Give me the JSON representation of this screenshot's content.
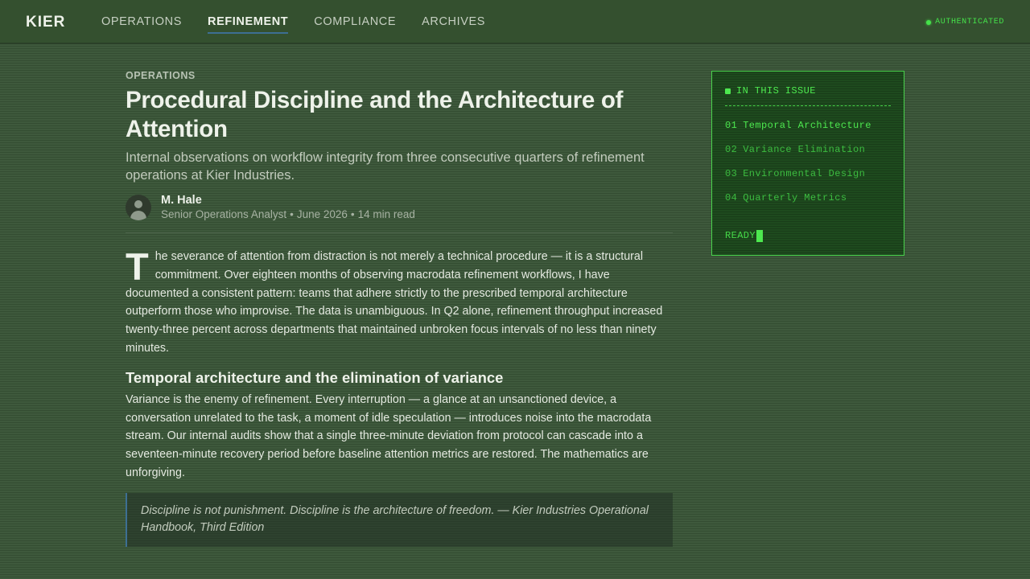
{
  "brand": "KIER",
  "nav": {
    "items": [
      {
        "label": "OPERATIONS"
      },
      {
        "label": "REFINEMENT"
      },
      {
        "label": "COMPLIANCE"
      },
      {
        "label": "ARCHIVES"
      }
    ],
    "active": "REFINEMENT",
    "status": "AUTHENTICATED"
  },
  "article": {
    "kicker": "OPERATIONS",
    "title": "Procedural Discipline and the Architecture of Attention",
    "subtitle": "Internal observations on workflow integrity from three consecutive quarters of refinement operations at Kier Industries.",
    "author": {
      "name": "M. Hale",
      "role": "Senior Operations Analyst",
      "date": "June 2026",
      "read_time": "14 min read",
      "separator": "•"
    },
    "dropcap": "T",
    "intro": "he severance of attention from distraction is not merely a technical procedure — it is a structural commitment. Over eighteen months of observing macrodata refinement workflows, I have documented a consistent pattern: teams that adhere strictly to the prescribed temporal architecture outperform those who improvise. The data is unambiguous. In Q2 alone, refinement throughput increased twenty-three percent across departments that maintained unbroken focus intervals of no less than ninety minutes.",
    "section_heading": "Temporal architecture and the elimination of variance",
    "section_body": "Variance is the enemy of refinement. Every interruption — a glance at an unsanctioned device, a conversation unrelated to the task, a moment of idle speculation — introduces noise into the macrodata stream. Our internal audits show that a single three-minute deviation from protocol can cascade into a seventeen-minute recovery period before baseline attention metrics are restored. The mathematics are unforgiving.",
    "quote": "Discipline is not punishment. Discipline is the architecture of freedom. — Kier Industries Operational Handbook, Third Edition"
  },
  "sidebar": {
    "header": "IN THIS ISSUE",
    "items": [
      {
        "num": "01",
        "label": "Temporal Architecture"
      },
      {
        "num": "02",
        "label": "Variance Elimination"
      },
      {
        "num": "03",
        "label": "Environmental Design"
      },
      {
        "num": "04",
        "label": "Quarterly Metrics"
      }
    ],
    "prompt": "READY"
  },
  "colors": {
    "background": "#3a5638",
    "nav_background": "#34502f",
    "accent_blue": "#3d6f93",
    "terminal_green": "#4de84f",
    "terminal_background": "#1e4a1e"
  }
}
